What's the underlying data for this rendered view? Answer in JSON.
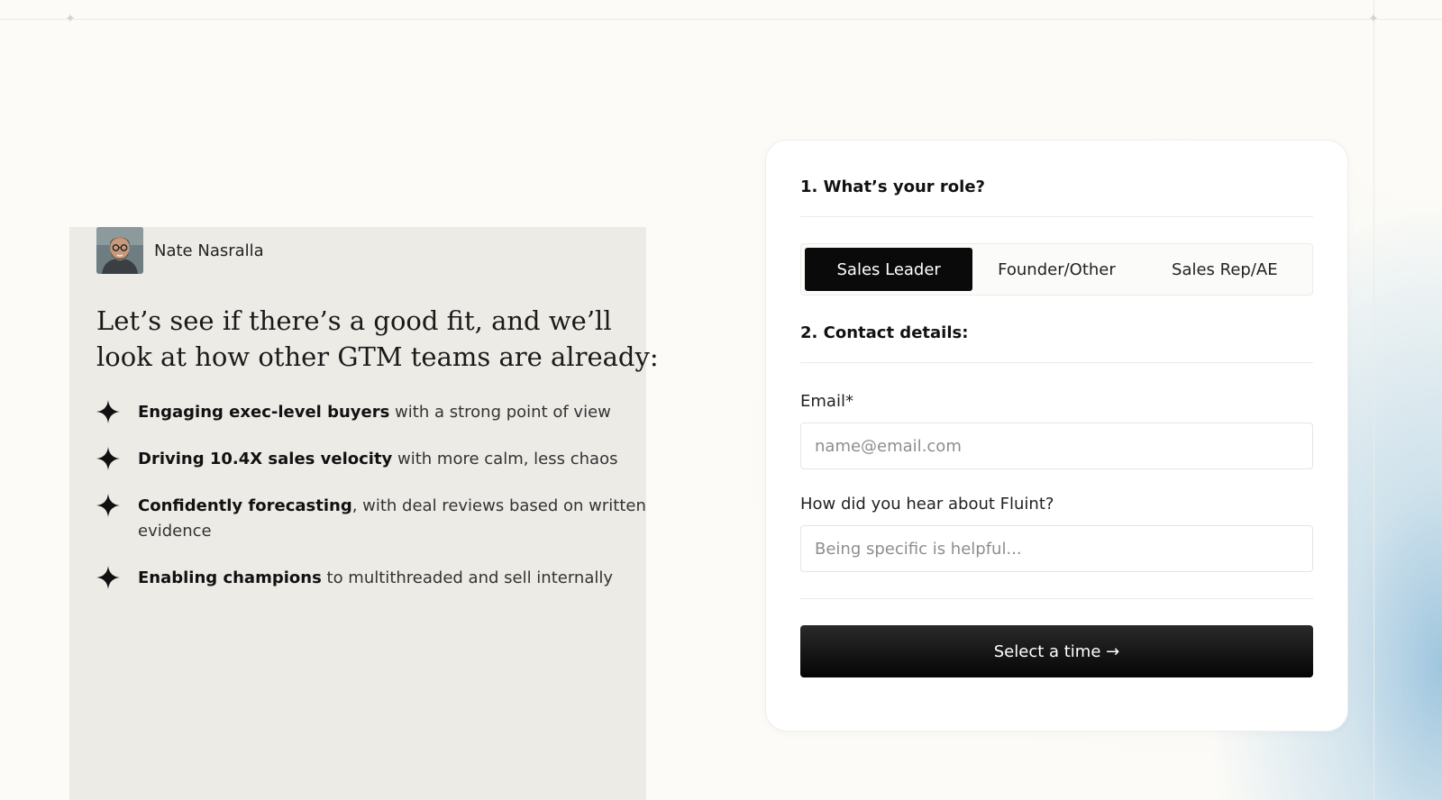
{
  "author": {
    "name": "Nate Nasralla"
  },
  "headline": "Let’s see if there’s a good fit, and we’ll look at how other GTM teams are already:",
  "bullets": [
    {
      "bold": "Engaging exec-level buyers",
      "rest": " with a strong point of view"
    },
    {
      "bold": "Driving 10.4X sales velocity",
      "rest": " with more calm, less chaos"
    },
    {
      "bold": "Confidently forecasting",
      "rest": ", with deal reviews based on written evidence"
    },
    {
      "bold": "Enabling champions",
      "rest": " to multithreaded and sell internally"
    }
  ],
  "form": {
    "role_title": "1. What’s your role?",
    "roles": [
      "Sales Leader",
      "Founder/Other",
      "Sales Rep/AE"
    ],
    "selected_role": "Sales Leader",
    "contact_title": "2. Contact details:",
    "email": {
      "label": "Email*",
      "placeholder": "name@email.com",
      "value": ""
    },
    "hear": {
      "label": "How did you hear about Fluint?",
      "placeholder": "Being specific is helpful...",
      "value": ""
    },
    "submit_label": "Select a time →"
  },
  "colors": {
    "background": "#fcfbf7",
    "accent": "#0a0a0a",
    "glow": "#80b4d6"
  },
  "icons": {
    "bullet": "four-point-star-icon",
    "corner": "four-point-star-icon"
  }
}
